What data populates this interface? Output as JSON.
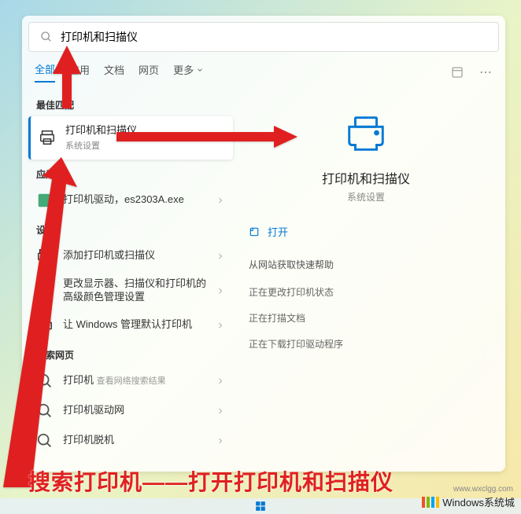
{
  "search": {
    "query": "打印机和扫描仪"
  },
  "tabs": {
    "all": "全部",
    "apps": "应用",
    "documents": "文档",
    "web": "网页",
    "more": "更多"
  },
  "sections": {
    "best_match": "最佳匹配",
    "apps": "应用",
    "settings": "设置",
    "search_web": "搜索网页"
  },
  "best_match": {
    "title": "打印机和扫描仪",
    "sub": "系统设置"
  },
  "app_items": [
    {
      "title": "打印机驱动，es2303A.exe"
    }
  ],
  "settings_items": [
    {
      "title": "添加打印机或扫描仪"
    },
    {
      "title": "更改显示器、扫描仪和打印机的高级颜色管理设置"
    },
    {
      "title": "让 Windows 管理默认打印机"
    }
  ],
  "web_items": [
    {
      "title": "打印机",
      "sub": "查看网络搜索结果"
    },
    {
      "title": "打印机驱动网"
    },
    {
      "title": "打印机脱机"
    }
  ],
  "detail": {
    "title": "打印机和扫描仪",
    "sub": "系统设置",
    "open": "打开",
    "quick_help": "从网站获取快速帮助",
    "quick_items": [
      "正在更改打印机状态",
      "正在打描文档",
      "正在下载打印驱动程序"
    ]
  },
  "annotation": "搜索打印机——打开打印机和扫描仪",
  "watermark": "Windows系统城",
  "watermark_url": "www.wxclgg.com"
}
